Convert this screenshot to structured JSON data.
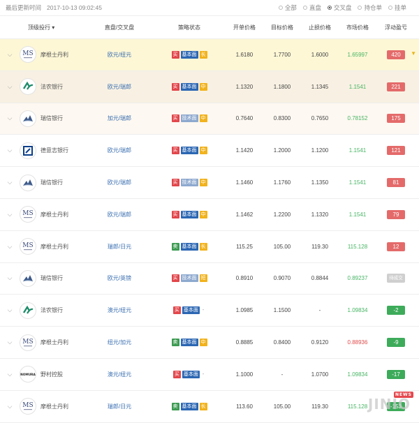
{
  "topbar": {
    "updated_label": "最后更新时间",
    "timestamp": "2017-10-13 09:02:45",
    "filters": [
      "全部",
      "直盘",
      "交叉盘",
      "持仓单",
      "挂单"
    ],
    "selected_filter": "交叉盘"
  },
  "table": {
    "headers": {
      "bank": "顶级投行 ▾",
      "pair": "直盘/交叉盘",
      "strategy": "策略状态",
      "open": "开单价格",
      "target": "目标价格",
      "stop": "止损价格",
      "market": "市场价格",
      "float": "浮动盈亏"
    },
    "rows": [
      {
        "bank": "摩根士丹利",
        "logo": "MS",
        "pair": "欧元/纽元",
        "action": "买",
        "strategy": "基本面",
        "term": "长",
        "open": "1.6180",
        "target": "1.7700",
        "stop": "1.6000",
        "market": "1.65997",
        "float": "420",
        "float_type": "pos",
        "flag": "▼"
      },
      {
        "bank": "法农银行",
        "logo": "CA",
        "pair": "欧元/瑞郎",
        "action": "买",
        "strategy": "基本面",
        "term": "中",
        "open": "1.1320",
        "target": "1.1800",
        "stop": "1.1345",
        "market": "1.1541",
        "float": "221",
        "float_type": "pos"
      },
      {
        "bank": "瑞信银行",
        "logo": "CS",
        "pair": "加元/瑞郎",
        "action": "买",
        "strategy": "技术面",
        "term": "中",
        "open": "0.7640",
        "target": "0.8300",
        "stop": "0.7650",
        "market": "0.78152",
        "float": "175",
        "float_type": "pos"
      },
      {
        "bank": "德意志银行",
        "logo": "DB",
        "pair": "欧元/瑞郎",
        "action": "买",
        "strategy": "基本面",
        "term": "中",
        "open": "1.1420",
        "target": "1.2000",
        "stop": "1.1200",
        "market": "1.1541",
        "float": "121",
        "float_type": "pos"
      },
      {
        "bank": "瑞信银行",
        "logo": "CS",
        "pair": "欧元/瑞郎",
        "action": "买",
        "strategy": "技术面",
        "term": "中",
        "open": "1.1460",
        "target": "1.1760",
        "stop": "1.1350",
        "market": "1.1541",
        "float": "81",
        "float_type": "pos"
      },
      {
        "bank": "摩根士丹利",
        "logo": "MS",
        "pair": "欧元/瑞郎",
        "action": "买",
        "strategy": "基本面",
        "term": "中",
        "open": "1.1462",
        "target": "1.2200",
        "stop": "1.1320",
        "market": "1.1541",
        "float": "79",
        "float_type": "pos"
      },
      {
        "bank": "摩根士丹利",
        "logo": "MS",
        "pair": "瑞郎/日元",
        "action": "卖",
        "strategy": "基本面",
        "term": "长",
        "open": "115.25",
        "target": "105.00",
        "stop": "119.30",
        "market": "115.128",
        "float": "12",
        "float_type": "pos"
      },
      {
        "bank": "瑞信银行",
        "logo": "CS",
        "pair": "欧元/英镑",
        "action": "买",
        "strategy": "技术面",
        "term": "短",
        "open": "0.8910",
        "target": "0.9070",
        "stop": "0.8844",
        "market": "0.89237",
        "float": "待成交",
        "float_type": "gray"
      },
      {
        "bank": "法农银行",
        "logo": "CA",
        "pair": "澳元/纽元",
        "action": "买",
        "strategy": "基本面",
        "term": "-",
        "open": "1.0985",
        "target": "1.1500",
        "stop": "-",
        "market": "1.09834",
        "float": "-2",
        "float_type": "neg"
      },
      {
        "bank": "摩根士丹利",
        "logo": "MS",
        "pair": "纽元/加元",
        "action": "卖",
        "strategy": "基本面",
        "term": "中",
        "open": "0.8885",
        "target": "0.8400",
        "stop": "0.9120",
        "market": "0.88936",
        "market_type": "down",
        "float": "-9",
        "float_type": "neg"
      },
      {
        "bank": "野村控股",
        "logo": "NOMURA",
        "pair": "澳元/纽元",
        "action": "买",
        "strategy": "基本面",
        "term": "-",
        "open": "1.1000",
        "target": "-",
        "stop": "1.0700",
        "market": "1.09834",
        "float": "-17",
        "float_type": "neg"
      },
      {
        "bank": "摩根士丹利",
        "logo": "MS",
        "pair": "瑞郎/日元",
        "action": "卖",
        "strategy": "基本面",
        "term": "长",
        "open": "113.60",
        "target": "105.00",
        "stop": "119.30",
        "market": "115.128",
        "float": "-153",
        "float_type": "neg"
      }
    ]
  },
  "watermark": {
    "text": "JINIO",
    "badge": "NEWS"
  }
}
